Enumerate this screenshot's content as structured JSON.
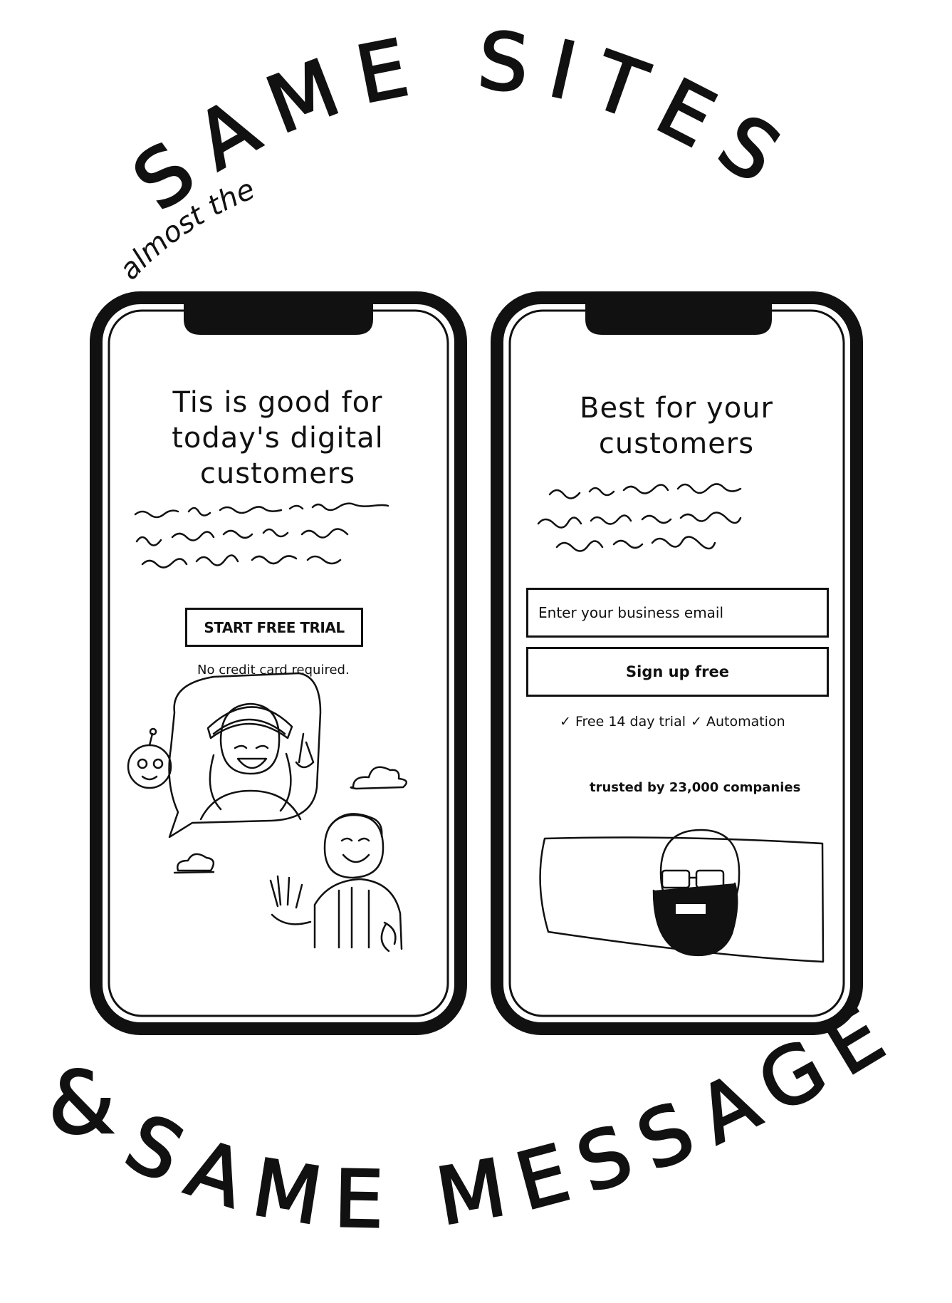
{
  "heading": {
    "line1": "SAME SITES",
    "prefix": "almost the",
    "footer_amp": "&",
    "footer_line": "SAME MESSAGES"
  },
  "left_phone": {
    "headline_lines": [
      "Tis is good for",
      "today's digital",
      "customers"
    ],
    "cta_label": "START FREE TRIAL",
    "note": "No credit card required."
  },
  "right_phone": {
    "headline_lines": [
      "Best for your",
      "customers"
    ],
    "email_placeholder": "Enter your business email",
    "signup_label": "Sign up free",
    "checks": [
      "Free 14 day trial",
      "Automation"
    ],
    "check_glyph": "✓",
    "trusted_text": "trusted by 23,000 companies"
  },
  "colors": {
    "ink": "#111111",
    "paper": "#ffffff"
  }
}
